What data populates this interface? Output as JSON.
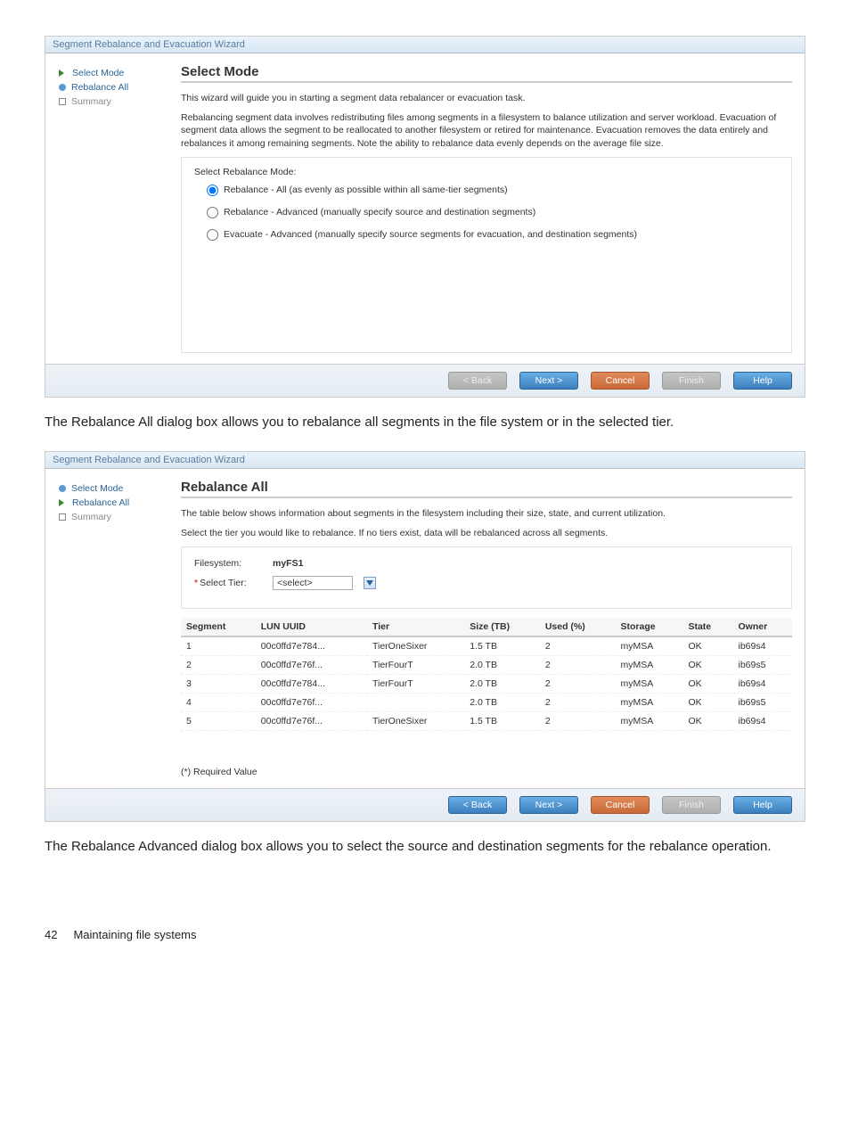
{
  "wizard1": {
    "title": "Segment Rebalance and Evacuation Wizard",
    "steps": [
      {
        "label": "Select Mode",
        "icon": "arrow",
        "active": true
      },
      {
        "label": "Rebalance All",
        "icon": "dot",
        "active": false
      },
      {
        "label": "Summary",
        "icon": "box",
        "active": false,
        "muted": true
      }
    ],
    "panel_title": "Select Mode",
    "desc1": "This wizard will guide you in starting a segment data rebalancer or evacuation task.",
    "desc2": "Rebalancing segment data involves redistributing files among segments in a filesystem to balance utilization and server workload. Evacuation of segment data allows the segment to be reallocated to another filesystem or retired for maintenance. Evacuation removes the data entirely and rebalances it among remaining segments. Note the ability to rebalance data evenly depends on the average file size.",
    "subhead": "Select Rebalance Mode:",
    "options": [
      {
        "label": "Rebalance - All (as evenly as possible within all same-tier segments)",
        "checked": true
      },
      {
        "label": "Rebalance - Advanced (manually specify source and destination segments)",
        "checked": false
      },
      {
        "label": "Evacuate - Advanced (manually specify source segments for evacuation, and destination segments)",
        "checked": false
      }
    ],
    "buttons": {
      "back": "< Back",
      "next": "Next >",
      "cancel": "Cancel",
      "finish": "Finish",
      "help": "Help"
    }
  },
  "mid_text": "The Rebalance All dialog box allows you to rebalance all segments in the file system or in the selected tier.",
  "wizard2": {
    "title": "Segment Rebalance and Evacuation Wizard",
    "steps": [
      {
        "label": "Select Mode",
        "icon": "dot",
        "active": false
      },
      {
        "label": "Rebalance All",
        "icon": "arrow",
        "active": true
      },
      {
        "label": "Summary",
        "icon": "box",
        "active": false,
        "muted": true
      }
    ],
    "panel_title": "Rebalance All",
    "desc1": "The table below shows information about segments in the filesystem including their size, state, and current utilization.",
    "desc2": "Select the tier you would like to rebalance. If no tiers exist, data will be rebalanced across all segments.",
    "fs_label": "Filesystem:",
    "fs_value": "myFS1",
    "tier_label": "Select Tier:",
    "tier_value": "<select>",
    "columns": [
      "Segment",
      "LUN UUID",
      "Tier",
      "Size (TB)",
      "Used (%)",
      "Storage",
      "State",
      "Owner"
    ],
    "rows": [
      {
        "segment": "1",
        "lun": "00c0ffd7e784...",
        "tier": "TierOneSixer",
        "size": "1.5 TB",
        "used": "2",
        "storage": "myMSA",
        "state": "OK",
        "owner": "ib69s4"
      },
      {
        "segment": "2",
        "lun": "00c0ffd7e76f...",
        "tier": "TierFourT",
        "size": "2.0 TB",
        "used": "2",
        "storage": "myMSA",
        "state": "OK",
        "owner": "ib69s5"
      },
      {
        "segment": "3",
        "lun": "00c0ffd7e784...",
        "tier": "TierFourT",
        "size": "2.0 TB",
        "used": "2",
        "storage": "myMSA",
        "state": "OK",
        "owner": "ib69s4"
      },
      {
        "segment": "4",
        "lun": "00c0ffd7e76f...",
        "tier": "",
        "size": "2.0 TB",
        "used": "2",
        "storage": "myMSA",
        "state": "OK",
        "owner": "ib69s5"
      },
      {
        "segment": "5",
        "lun": "00c0ffd7e76f...",
        "tier": "TierOneSixer",
        "size": "1.5 TB",
        "used": "2",
        "storage": "myMSA",
        "state": "OK",
        "owner": "ib69s4"
      }
    ],
    "req_note": "(*) Required Value",
    "buttons": {
      "back": "< Back",
      "next": "Next >",
      "cancel": "Cancel",
      "finish": "Finish",
      "help": "Help"
    }
  },
  "end_text": "The Rebalance Advanced dialog box allows you to select the source and destination segments for the rebalance operation.",
  "footer": {
    "page": "42",
    "section": "Maintaining file systems"
  }
}
